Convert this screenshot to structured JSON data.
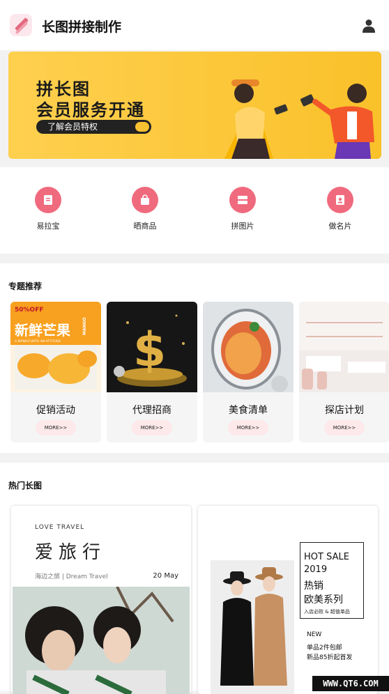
{
  "header": {
    "title": "长图拼接制作",
    "logo_icon": "app-logo-icon",
    "user_icon": "user-icon"
  },
  "banner": {
    "line1": "拼长图",
    "line2": "会员服务开通",
    "cta": "了解会员特权"
  },
  "quick_actions": [
    {
      "label": "易拉宝",
      "icon": "rollup-banner-icon"
    },
    {
      "label": "晒商品",
      "icon": "shopping-bag-icon"
    },
    {
      "label": "拼图片",
      "icon": "collage-icon"
    },
    {
      "label": "做名片",
      "icon": "business-card-icon"
    }
  ],
  "topics": {
    "title": "专题推荐",
    "items": [
      {
        "name": "促销活动",
        "more": "MORE>>",
        "image_texts": [
          "50%OFF",
          "新鲜芒果",
          "MANGO",
          "A MANGO WITH AN ATTITUDE"
        ]
      },
      {
        "name": "代理招商",
        "more": "MORE>>"
      },
      {
        "name": "美食清单",
        "more": "MORE>>"
      },
      {
        "name": "探店计划",
        "more": "MORE>>"
      }
    ]
  },
  "hot": {
    "title": "热门长图",
    "cards": [
      {
        "tag": "LOVE   TRAVEL",
        "title": "爱旅行",
        "subtitle": "海边之旅 | Dream Travel",
        "date": "20 May"
      },
      {
        "lines": [
          "HOT SALE",
          "2019",
          "热销",
          "欧美系列",
          "入店必败 & 超值单品"
        ],
        "new_lines": [
          "NEW",
          "单品2件包邮",
          "新品85折起首发"
        ]
      }
    ]
  },
  "watermark": "WWW.QT6.COM",
  "colors": {
    "accent": "#f06a7d",
    "banner_yellow": "#ffd04f",
    "more_pill": "#fde8ea"
  }
}
